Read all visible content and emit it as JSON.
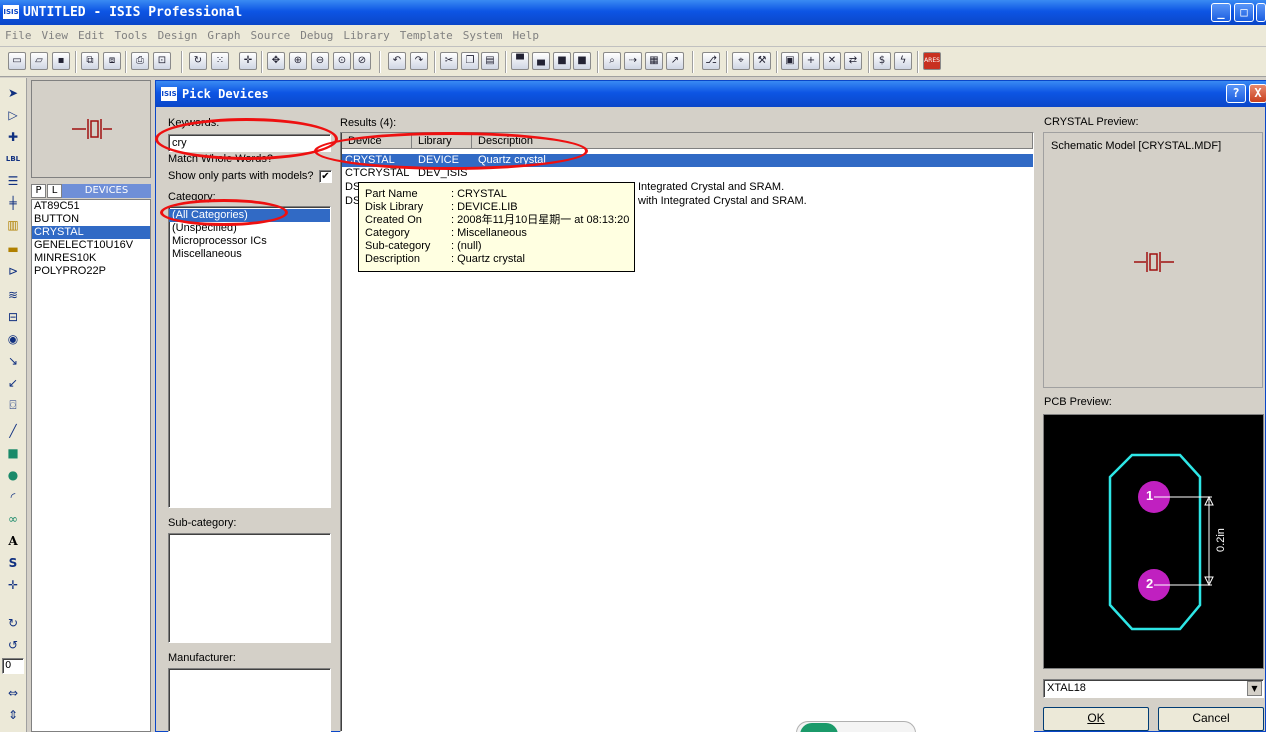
{
  "app": {
    "title": "UNTITLED - ISIS Professional",
    "logo": "ISIS",
    "window_buttons": [
      "_",
      "□",
      "X"
    ]
  },
  "menu": [
    "File",
    "View",
    "Edit",
    "Tools",
    "Design",
    "Graph",
    "Source",
    "Debug",
    "Library",
    "Template",
    "System",
    "Help"
  ],
  "toolbar": {
    "icons": [
      "new-icon",
      "open-icon",
      "save-icon",
      "import-icon",
      "export-icon",
      "print-icon",
      "area-icon",
      "refresh-icon",
      "grid-icon",
      "origin-icon",
      "pan-icon",
      "zoom-in-icon",
      "zoom-out-icon",
      "zoom-all-icon",
      "zoom-area-icon",
      "undo-icon",
      "redo-icon",
      "cut-icon",
      "copy-icon",
      "paste-icon",
      "block-copy-icon",
      "block-move-icon",
      "block-rotate-icon",
      "block-delete-icon",
      "pick-device-icon",
      "make-device-icon",
      "package-icon",
      "decompose-icon",
      "wire-autorouter-icon",
      "search-icon",
      "property-tool-icon",
      "new-sheet-icon",
      "add-sheet-icon",
      "remove-sheet-icon",
      "goto-sheet-icon",
      "bom-icon",
      "erc-icon",
      "ares-icon"
    ],
    "ares_label": "ARES"
  },
  "left_tools": [
    "selection-icon",
    "component-icon",
    "junction-icon",
    "label-icon",
    "text-script-icon",
    "bus-icon",
    "subcircuit-icon",
    "terminal-icon",
    "pin-icon",
    "graph-icon",
    "tape-icon",
    "generator-icon",
    "voltage-probe-icon",
    "current-probe-icon",
    "virtual-instrument-icon",
    "line-icon",
    "box-icon",
    "circle-icon",
    "arc-icon",
    "path-icon",
    "text-icon",
    "symbol-icon",
    "marker-icon",
    "rotate-cw-icon",
    "rotate-ccw-icon",
    "mirror-x-icon",
    "mirror-y-icon"
  ],
  "rotation_value": "0",
  "device_panel": {
    "tab_p": "P",
    "tab_l": "L",
    "tab_label": "DEVICES",
    "items": [
      "AT89C51",
      "BUTTON",
      "CRYSTAL",
      "GENELECT10U16V",
      "MINRES10K",
      "POLYPRO22P"
    ],
    "selected": "CRYSTAL"
  },
  "dialog": {
    "logo": "ISIS",
    "title": "Pick Devices",
    "help_button": "?",
    "close_button": "X",
    "keywords_label": "Keywords:",
    "keywords_value": "cry",
    "match_whole_words_label": "Match Whole Words?",
    "show_only_models_label": "Show only parts with models?",
    "show_only_models_checked": true,
    "category_label": "Category:",
    "categories": [
      "(All Categories)",
      "(Unspecified)",
      "Microprocessor ICs",
      "Miscellaneous"
    ],
    "selected_category": "(All Categories)",
    "subcategory_label": "Sub-category:",
    "manufacturer_label": "Manufacturer:",
    "results_label": "Results (4):",
    "columns": [
      "Device",
      "Library",
      "Description"
    ],
    "results": [
      {
        "device": "CRYSTAL",
        "library": "DEVICE",
        "description": "Quartz crystal"
      },
      {
        "device": "CTCRYSTAL",
        "library": "DEV_ISIS",
        "description": ""
      },
      {
        "device": "DS",
        "library": "",
        "description": "Integrated Crystal and SRAM."
      },
      {
        "device": "DS",
        "library": "",
        "description": "with Integrated Crystal and SRAM."
      }
    ],
    "tooltip": [
      {
        "key": "Part Name",
        "value": ": CRYSTAL"
      },
      {
        "key": "Disk Library",
        "value": ": DEVICE.LIB"
      },
      {
        "key": "Created On",
        "value": ": 2008年11月10日星期一 at 08:13:20"
      },
      {
        "key": "Category",
        "value": ": Miscellaneous"
      },
      {
        "key": "Sub-category",
        "value": ": (null)"
      },
      {
        "key": "Description",
        "value": ": Quartz crystal"
      }
    ],
    "schematic_preview_label": "CRYSTAL Preview:",
    "schematic_model_text": "Schematic Model [CRYSTAL.MDF]",
    "pcb_preview_label": "PCB Preview:",
    "pcb_pin_1": "1",
    "pcb_pin_2": "2",
    "pcb_dimension": "0.2in",
    "package_value": "XTAL18",
    "ok_label": "OK",
    "cancel_label": "Cancel"
  },
  "colors": {
    "title_blue": "#0a46c8",
    "selection_blue": "#316ac5",
    "annotation_red": "#ee1010",
    "pcb_outline": "#2ee6e6",
    "pcb_pad": "#c020c0",
    "component_red": "#a01010"
  }
}
